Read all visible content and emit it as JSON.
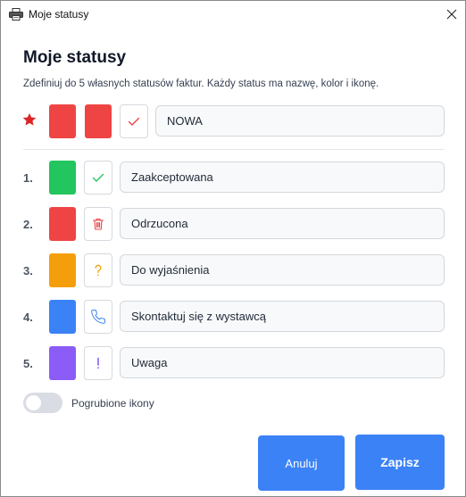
{
  "window": {
    "title": "Moje statusy",
    "icon": "printer-icon",
    "close_icon": "close-icon"
  },
  "dialog": {
    "heading": "Moje statusy",
    "subtitle": "Zdefiniuj do 5 własnych statusów faktur. Każdy status ma nazwę, kolor i ikonę."
  },
  "default_status": {
    "marker_icon": "star-icon",
    "color_1": "#ef4444",
    "color_2": "#ef4444",
    "icon": "check-icon",
    "icon_color": "#ef4444",
    "name": "NOWA"
  },
  "statuses": [
    {
      "number": "1.",
      "color": "#22c55e",
      "icon": "check-icon",
      "icon_color": "#22c55e",
      "name": "Zaakceptowana"
    },
    {
      "number": "2.",
      "color": "#ef4444",
      "icon": "trash-icon",
      "icon_color": "#ef4444",
      "name": "Odrzucona"
    },
    {
      "number": "3.",
      "color": "#f59e0b",
      "icon": "question-icon",
      "icon_color": "#f59e0b",
      "name": "Do wyjaśnienia"
    },
    {
      "number": "4.",
      "color": "#3b82f6",
      "icon": "phone-icon",
      "icon_color": "#3b82f6",
      "name": "Skontaktuj się z wystawcą"
    },
    {
      "number": "5.",
      "color": "#8b5cf6",
      "icon": "exclamation-icon",
      "icon_color": "#8b5cf6",
      "name": "Uwaga"
    }
  ],
  "bold_icons_toggle": {
    "label": "Pogrubione ikony",
    "checked": false
  },
  "buttons": {
    "cancel_label": "Anuluj",
    "save_label": "Zapisz",
    "accent": "#3b82f6"
  }
}
